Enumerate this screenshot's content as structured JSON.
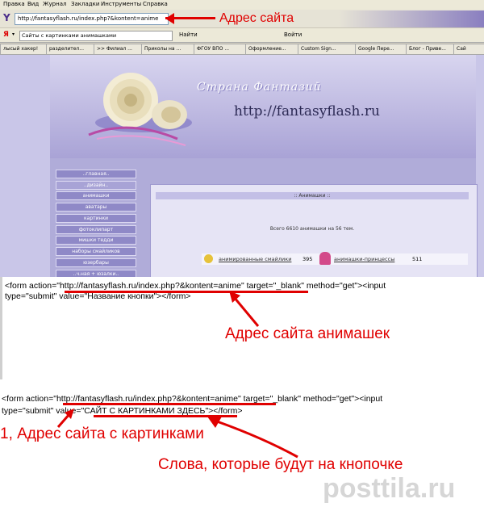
{
  "menu": {
    "items": [
      "Правка",
      "Вид",
      "Журнал",
      "Закладки",
      "Инструменты",
      "Справка"
    ]
  },
  "address": {
    "url": "http://fantasyflash.ru/index.php?&kontent=anime",
    "annotation": "Адрес сайта"
  },
  "toolbar": {
    "search_text": "Сайты с картинками анимашками",
    "find_label": "Найти",
    "login_label": "Войти"
  },
  "tabs": [
    "лысый хакер!",
    "разделител...",
    ">> Филиал ...",
    "Приколы на ...",
    "ФГОУ ВПО ...",
    "Оформление...",
    "Custom Sign...",
    "Google Пере...",
    "Блог - Приве...",
    "Сай"
  ],
  "site": {
    "title": "Страна Фантазий",
    "url": "http://fantasyflash.ru",
    "nav": [
      "..главная..",
      "..дизайн..",
      "анимашки",
      "аватары",
      "картинки",
      "фотоклипарт",
      "мишки тедди",
      "наборы смайликов",
      "юзербары",
      "..ч.ная + юзалки.."
    ],
    "panel_title": ":: Анимашки ::",
    "total": "Всего 6610 анимашки на 56 тем.",
    "row": {
      "left_link": "анимированные смайлики",
      "left_count": "395",
      "right_link": "анимашки-принцессы",
      "right_count": "511"
    }
  },
  "code1": {
    "line1_pre": "<form action=\"",
    "line1_url": "http://fantasyflash.ru/index.php?&kontent=anime",
    "line1_post": "\" target=\"_blank\" method=\"get\"><input",
    "line2": "type=\"submit\" value=\"Название кнопки\"></form>",
    "annotation": "Адрес сайта анимашек"
  },
  "code2": {
    "line1_pre": "<form action=\"",
    "line1_url": "http://fantasyflash.ru/index.php?&kontent=anime",
    "line1_post": "\" target=\"_blank\" method=\"get\"><input",
    "line2_pre": "type=\"submit\" value=\"",
    "line2_value": "САЙТ С КАРТИНКАМИ ЗДЕСЬ",
    "line2_post": "\"></form>",
    "annotation1": "1, Адрес сайта с картинками",
    "annotation2": "Слова, которые будут на кнопочке"
  },
  "watermark": "posttila.ru",
  "colors": {
    "accent_red": "#e00000",
    "site_purple": "#8f89c7"
  }
}
